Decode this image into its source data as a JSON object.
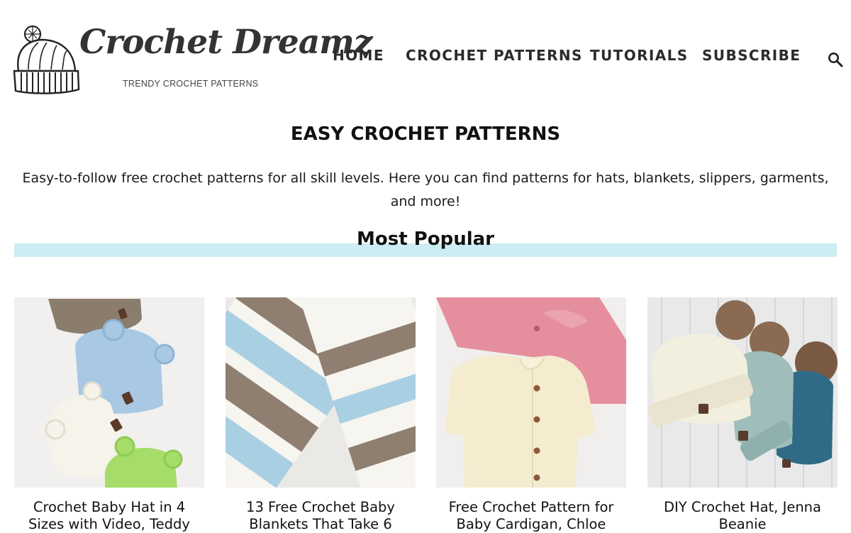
{
  "brand": {
    "title": "Crochet Dreamz",
    "tagline": "TRENDY CROCHET PATTERNS"
  },
  "nav": {
    "items": [
      "HOME",
      "CROCHET PATTERNS",
      "TUTORIALS",
      "SUBSCRIBE"
    ]
  },
  "search": {
    "icon": "search-icon"
  },
  "page": {
    "title": "EASY CROCHET PATTERNS",
    "intro": "Easy-to-follow free crochet patterns for all skill levels. Here you can find patterns for hats, blankets, slippers, garments, and more!"
  },
  "popular": {
    "heading": "Most Popular",
    "accent_color": "#ccedf2",
    "cards": [
      {
        "caption": "Crochet Baby Hat in 4 Sizes with Video, Teddy"
      },
      {
        "caption": "13 Free Crochet Baby Blankets That Take 6"
      },
      {
        "caption": "Free Crochet Pattern for Baby Cardigan, Chloe"
      },
      {
        "caption": "DIY Crochet Hat, Jenna Beanie"
      }
    ]
  }
}
